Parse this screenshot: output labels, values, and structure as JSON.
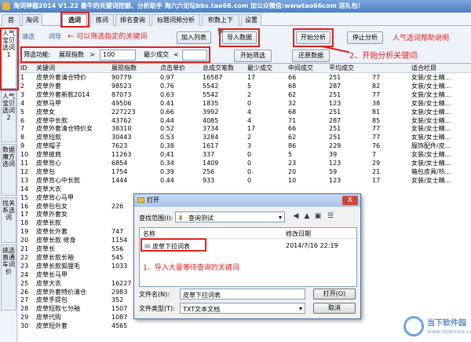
{
  "window": {
    "title": "淘词神器2014 V1.22 最牛的关键词挖掘、分析助手 淘六六论坛bbs.tao66.com 加公众微信:wwwtao66com 送礼包！"
  },
  "menu": [
    "首页",
    "淘词",
    "选词",
    "拣词",
    "排名查询",
    "标题词频分析",
    "积数上下架",
    "设置"
  ],
  "sidebar": [
    "人气宝贝选词1",
    "人气宝贝选词2",
    "数据魔方选词",
    "找关系选词",
    "挑选直通车词价"
  ],
  "toolbar": {
    "hint_left": "请选",
    "hint_mid": "词导",
    "annotation_filter": "可以筛选指定的关键词",
    "add_list": "加入列表",
    "import": "导入数据",
    "start": "开始分析",
    "stop": "停止分析",
    "help": "人气选词帮助说明",
    "annotation_start": "2、开始分析关键词"
  },
  "filter": {
    "label": "筛选功能:",
    "field1": "展现指数",
    "op": ">",
    "value": "100",
    "field2": "最少成交",
    "op2": "<",
    "run": "开始筛选",
    "restore": "还原数据"
  },
  "table": {
    "columns": [
      "ID",
      "关键词",
      "展现指数",
      "点击单价",
      "总成交笔数",
      "最少成交",
      "中间成交",
      "平均成交",
      "适合栏目"
    ],
    "rows": [
      [
        "1",
        "皮草外套清仓特价",
        "90779",
        "0.97",
        "16587",
        "17",
        "66",
        "251",
        "77",
        "女装/女士精..."
      ],
      [
        "2",
        "皮草外套",
        "98523",
        "0.76",
        "5542",
        "5",
        "68",
        "287",
        "82",
        "女装/女士精..."
      ],
      [
        "3",
        "皮草外套新款2014",
        "87073",
        "0.63",
        "5542",
        "2",
        "62",
        "251",
        "77",
        "女装/女士精..."
      ],
      [
        "4",
        "皮草马甲",
        "49506",
        "0.41",
        "1835",
        "0",
        "32",
        "123",
        "38",
        "女装/女士精..."
      ],
      [
        "5",
        "皮草女",
        "227223",
        "0.66",
        "3992",
        "4",
        "68",
        "251",
        "81",
        "女装/女士精..."
      ],
      [
        "6",
        "皮草中长款",
        "43762",
        "0.44",
        "4085",
        "4",
        "71",
        "287",
        "85",
        "女装/女士精..."
      ],
      [
        "7",
        "皮草外套清仓特价女",
        "38310",
        "0.52",
        "3734",
        "17",
        "66",
        "251",
        "77",
        "女装/女士精..."
      ],
      [
        "8",
        "皮草短款",
        "30443",
        "0.53",
        "3284",
        "2",
        "62",
        "251",
        "77",
        "女装/女士精..."
      ],
      [
        "9",
        "皮草帽子",
        "7623",
        "0.38",
        "1617",
        "3",
        "86",
        "229",
        "76",
        "服饰配件/皮..."
      ],
      [
        "10",
        "皮草披肩",
        "11263",
        "0.41",
        "337",
        "0",
        "5",
        "39",
        "7",
        "女装/女士精..."
      ],
      [
        "11",
        "皮草背心",
        "6854",
        "0.34",
        "1409",
        "0",
        "23",
        "123",
        "29",
        "女装/女士精..."
      ],
      [
        "12",
        "皮草包",
        "1754",
        "0.39",
        "256",
        "0",
        "20",
        "59",
        "21",
        "箱包皮具/热..."
      ],
      [
        "13",
        "皮草背心中长款",
        "1444",
        "0.44",
        "933",
        "0",
        "10",
        "123",
        "17",
        "女装/女士精..."
      ],
      [
        "14",
        "皮草大衣",
        "",
        "",
        "",
        "",
        "",
        "",
        "",
        ""
      ],
      [
        "15",
        "皮草背心马甲",
        "",
        "",
        "",
        "",
        "",
        "",
        "",
        ""
      ],
      [
        "16",
        "皮草包包女",
        "226",
        "",
        "",
        "",
        "",
        "",
        "",
        ""
      ],
      [
        "17",
        "皮草外套女",
        "",
        "",
        "",
        "",
        "",
        "",
        "",
        ""
      ],
      [
        "18",
        "皮草长款",
        "",
        "",
        "",
        "",
        "",
        "",
        "",
        ""
      ],
      [
        "19",
        "皮草长外套",
        "747",
        "",
        "",
        "",
        "",
        "",
        "",
        ""
      ],
      [
        "20",
        "皮草长款 修身",
        "1154",
        "",
        "",
        "",
        "",
        "",
        "",
        ""
      ],
      [
        "21",
        "皮草长",
        "556",
        "",
        "",
        "",
        "",
        "",
        "",
        ""
      ],
      [
        "22",
        "皮草长款长袖",
        "545",
        "",
        "",
        "",
        "",
        "",
        "",
        ""
      ],
      [
        "23",
        "皮草长款狐狸毛",
        "1033",
        "",
        "",
        "",
        "",
        "",
        "",
        ""
      ],
      [
        "24",
        "皮草长马甲",
        "",
        "",
        "",
        "",
        "",
        "",
        "",
        ""
      ],
      [
        "25",
        "皮草大衣",
        "16227",
        "",
        "",
        "",
        "",
        "",
        "",
        ""
      ],
      [
        "26",
        "皮草外套特价清仓",
        "2983",
        "",
        "",
        "",
        "",
        "",
        "",
        ""
      ],
      [
        "27",
        "皮草手提包",
        "352",
        "",
        "",
        "",
        "",
        "",
        "",
        ""
      ],
      [
        "28",
        "皮草短款七分袖",
        "1507",
        "",
        "",
        "",
        "",
        "",
        "",
        ""
      ],
      [
        "29",
        "皮草代购",
        "1087",
        "",
        "",
        "",
        "",
        "",
        "",
        ""
      ],
      [
        "30",
        "皮草短外套",
        "4565",
        "",
        "",
        "",
        "",
        "",
        "",
        ""
      ]
    ]
  },
  "dialog": {
    "title": "打开",
    "lookin_label": "查找范围(I):",
    "lookin_value": "查询测试",
    "col_name": "名称",
    "col_date": "修改日期",
    "file_name": "皮草下拉词表",
    "file_date": "2014/7/16 22:19",
    "annotation": "1、导入大量等待查询的关键词",
    "filename_label": "文件名(N):",
    "filename_value": "皮草下拉词表",
    "filetype_label": "文件类型(T):",
    "filetype_value": "TXT文本文档",
    "open": "打开(O)",
    "cancel": "取消",
    "close": "X"
  },
  "watermark": {
    "name": "当下软件园",
    "url": "www.downxia.com"
  },
  "colors": {
    "annotation": "#e0201c",
    "titlebar": "#4c7fc4"
  }
}
